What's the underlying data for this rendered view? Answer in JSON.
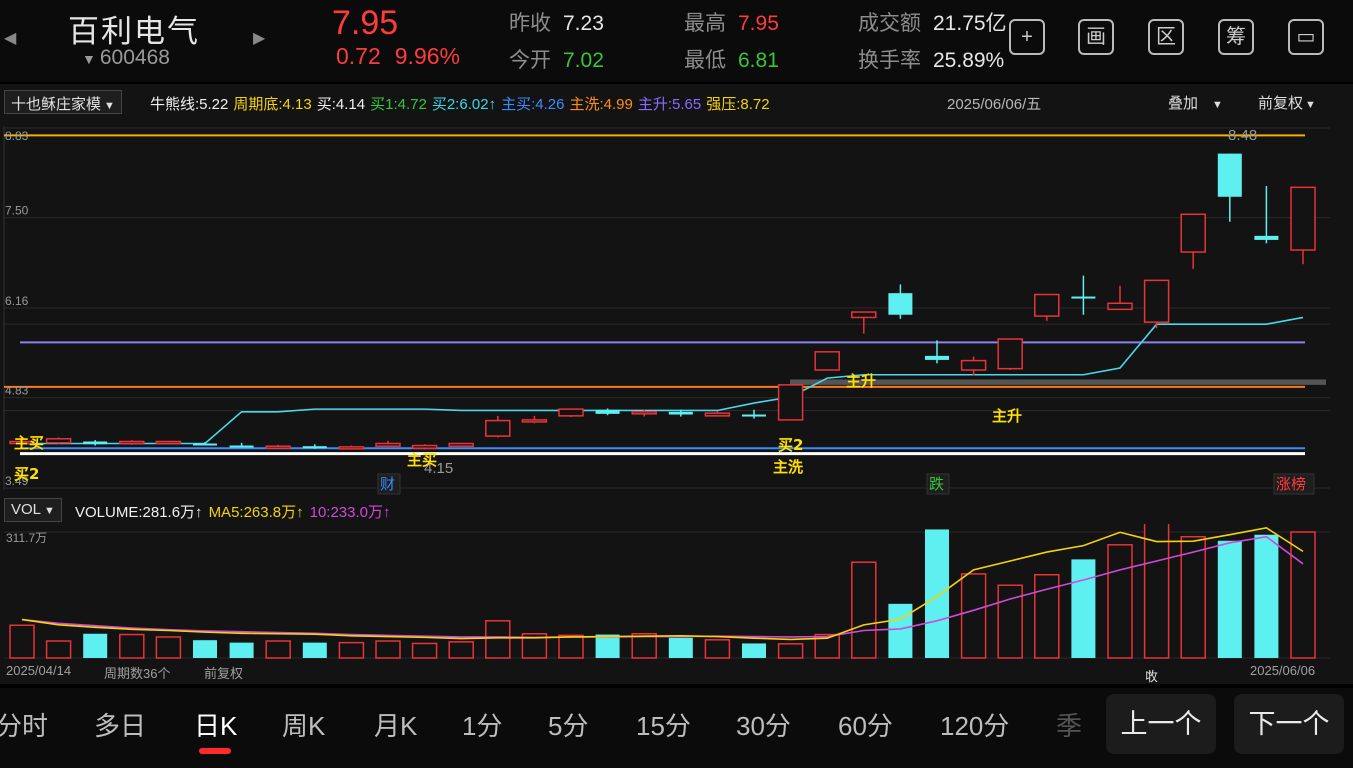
{
  "header": {
    "name": "百利电气",
    "code": "600468",
    "price": "7.95",
    "change": "0.72",
    "change_pct": "9.96%",
    "prev_close_label": "昨收",
    "prev_close": "7.23",
    "open_label": "今开",
    "open": "7.02",
    "high_label": "最高",
    "high": "7.95",
    "low_label": "最低",
    "low": "6.81",
    "turnover_label": "成交额",
    "turnover": "21.75亿",
    "rate_label": "换手率",
    "rate": "25.89%",
    "buttons": [
      {
        "name": "add-icon",
        "glyph": "+"
      },
      {
        "name": "draw-icon",
        "glyph": "画"
      },
      {
        "name": "range-icon",
        "glyph": "区"
      },
      {
        "name": "chips-icon",
        "glyph": "筹"
      },
      {
        "name": "landscape-icon",
        "glyph": "▭"
      }
    ]
  },
  "indicator_bar": {
    "select": "十也稣庄家模",
    "values": [
      {
        "text": "牛熊线:5.22",
        "color": "#f0f0f0"
      },
      {
        "text": "周期底:4.13",
        "color": "#f5d20a"
      },
      {
        "text": "买:4.14",
        "color": "#f0f0f0"
      },
      {
        "text": "买1:4.72",
        "color": "#38c53a"
      },
      {
        "text": "买2:6.02↑",
        "color": "#38d8e8"
      },
      {
        "text": "主买:4.26",
        "color": "#3a8bff"
      },
      {
        "text": "主洗:4.99",
        "color": "#ff8c1a"
      },
      {
        "text": "主升:5.65",
        "color": "#8a6bff"
      },
      {
        "text": "强压:8.72",
        "color": "#f5d20a"
      }
    ],
    "date": "2025/06/06/五",
    "overlay": "叠加",
    "adjust": "前复权"
  },
  "volume_bar": {
    "select": "VOL",
    "values": [
      {
        "text": "VOLUME:281.6万↑",
        "color": "#f0f0f0"
      },
      {
        "text": "MA5:263.8万↑",
        "color": "#f5d20a"
      },
      {
        "text": "10:233.0万↑",
        "color": "#d04ad8"
      }
    ]
  },
  "footer": {
    "start_date": "2025/04/14",
    "period_count": "周期数36个",
    "adjust": "前复权",
    "collapse": "收起副图",
    "end_date": "2025/06/06"
  },
  "tabs": [
    "分时",
    "多日",
    "日K",
    "周K",
    "月K",
    "1分",
    "5分",
    "15分",
    "30分",
    "60分",
    "120分",
    "季"
  ],
  "active_tab": "日K",
  "nav": {
    "prev": "上一个",
    "next": "下一个"
  },
  "colors": {
    "up": "#e8333a",
    "down": "#5ef0f0",
    "cyan_line": "#4ad8ec",
    "purple_line": "#8a80f0",
    "orange_line": "#ff7a1a",
    "gold_line": "#f0b400"
  },
  "chart_data": {
    "type": "candlestick",
    "yaxis_ticks": [
      "8.83",
      "7.50",
      "6.16",
      "4.83",
      "3.49"
    ],
    "ylim": [
      3.49,
      8.83
    ],
    "price_annotations": [
      "8.48",
      "4.15"
    ],
    "signals": [
      "主买",
      "买2",
      "主买",
      "买2",
      "主洗",
      "主升",
      "主升"
    ],
    "events": [
      {
        "text": "财",
        "color": "#3a8bff"
      },
      {
        "text": "跌",
        "color": "#38c53a"
      },
      {
        "text": "涨榜",
        "color": "#ff3b3b"
      }
    ],
    "volume_ylabel": "311.7万",
    "candles": [
      [
        4.16,
        4.18,
        4.12,
        4.22
      ],
      [
        4.16,
        4.22,
        4.14,
        4.24
      ],
      [
        4.18,
        4.14,
        4.12,
        4.2
      ],
      [
        4.15,
        4.18,
        4.13,
        4.2
      ],
      [
        4.16,
        4.18,
        4.14,
        4.19
      ],
      [
        4.15,
        4.14,
        4.13,
        4.17
      ],
      [
        4.12,
        4.1,
        4.09,
        4.16
      ],
      [
        4.09,
        4.11,
        4.08,
        4.13
      ],
      [
        4.11,
        4.08,
        4.07,
        4.14
      ],
      [
        4.08,
        4.1,
        4.07,
        4.12
      ],
      [
        4.11,
        4.15,
        4.1,
        4.19
      ],
      [
        4.08,
        4.12,
        4.06,
        4.14
      ],
      [
        4.11,
        4.15,
        4.1,
        4.16
      ],
      [
        4.26,
        4.49,
        4.24,
        4.56
      ],
      [
        4.5,
        4.5,
        4.45,
        4.56
      ],
      [
        4.56,
        4.66,
        4.54,
        4.67
      ],
      [
        4.65,
        4.59,
        4.57,
        4.67
      ],
      [
        4.59,
        4.62,
        4.55,
        4.65
      ],
      [
        4.62,
        4.58,
        4.55,
        4.65
      ],
      [
        4.56,
        4.6,
        4.55,
        4.63
      ],
      [
        4.58,
        4.55,
        4.52,
        4.65
      ],
      [
        4.5,
        5.02,
        4.5,
        5.02
      ],
      [
        5.24,
        5.51,
        5.24,
        5.51
      ],
      [
        6.02,
        6.1,
        5.78,
        6.1
      ],
      [
        6.38,
        6.06,
        6.0,
        6.51
      ],
      [
        5.45,
        5.39,
        5.34,
        5.68
      ],
      [
        5.24,
        5.38,
        5.16,
        5.44
      ],
      [
        5.26,
        5.7,
        5.24,
        5.7
      ],
      [
        6.04,
        6.36,
        5.97,
        6.36
      ],
      [
        6.33,
        6.32,
        6.06,
        6.64
      ],
      [
        6.14,
        6.23,
        6.14,
        6.49
      ],
      [
        5.95,
        6.57,
        5.86,
        6.57
      ],
      [
        6.99,
        7.55,
        6.74,
        7.55
      ],
      [
        8.45,
        7.81,
        7.44,
        8.45
      ],
      [
        7.23,
        7.17,
        7.12,
        7.97
      ],
      [
        7.02,
        7.95,
        6.81,
        7.95
      ]
    ],
    "volume": [
      81,
      42,
      60,
      58,
      52,
      44,
      38,
      42,
      38,
      38,
      42,
      36,
      40,
      92,
      60,
      56,
      58,
      60,
      50,
      45,
      36,
      35,
      58,
      237,
      134,
      318,
      208,
      180,
      206,
      244,
      280,
      335,
      300,
      290,
      305,
      311.7,
      281.6
    ],
    "ma5": [
      95,
      82,
      76,
      71,
      68,
      64,
      61,
      60,
      59,
      55,
      53,
      51,
      48,
      50,
      50,
      52,
      53,
      54,
      55,
      53,
      49,
      46,
      49,
      82,
      96,
      152,
      218,
      240,
      262,
      278,
      311,
      288,
      289,
      305,
      322,
      263.8
    ],
    "ma10": [
      95,
      86,
      80,
      74,
      70,
      67,
      65,
      63,
      61,
      58,
      56,
      54,
      52,
      52,
      51,
      52,
      52,
      53,
      53,
      54,
      53,
      52,
      53,
      68,
      72,
      92,
      118,
      146,
      170,
      193,
      218,
      240,
      262,
      285,
      300,
      233.0
    ],
    "lines": {
      "cyan": [
        4.15,
        4.15,
        4.15,
        4.15,
        4.15,
        4.15,
        4.62,
        4.62,
        4.66,
        4.66,
        4.66,
        4.66,
        4.64,
        4.64,
        4.64,
        4.64,
        4.64,
        4.64,
        4.64,
        4.64,
        4.75,
        4.84,
        5.12,
        5.17,
        5.17,
        5.17,
        5.17,
        5.17,
        5.17,
        5.17,
        5.27,
        5.92,
        5.92,
        5.92,
        5.92,
        6.02
      ],
      "purple": 5.65,
      "orange": 4.99,
      "gold": 8.72,
      "white": 4.0,
      "blue": 4.08,
      "gray_band": [
        5.02,
        5.1
      ]
    }
  }
}
